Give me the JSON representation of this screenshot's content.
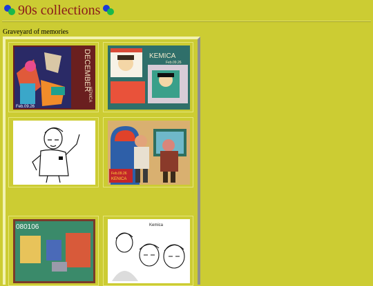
{
  "page": {
    "title": "90s collections",
    "subtitle": "Graveyard of memories"
  },
  "gallery": {
    "items": [
      {
        "caption": "DECEMBER",
        "date": "Feb.09.26",
        "artist": "KENICA"
      },
      {
        "caption": "KEMICA",
        "date": "Feb.09.26"
      },
      {
        "caption": ""
      },
      {
        "caption": "KENICA",
        "date": "Feb.09.26"
      },
      {
        "caption": "080106"
      },
      {
        "caption": "Kemica"
      }
    ]
  },
  "colors": {
    "background": "#cccc33",
    "title": "#8a1a1a"
  },
  "icons": [
    "bullet-ball-icon",
    "bullet-ball-icon"
  ]
}
